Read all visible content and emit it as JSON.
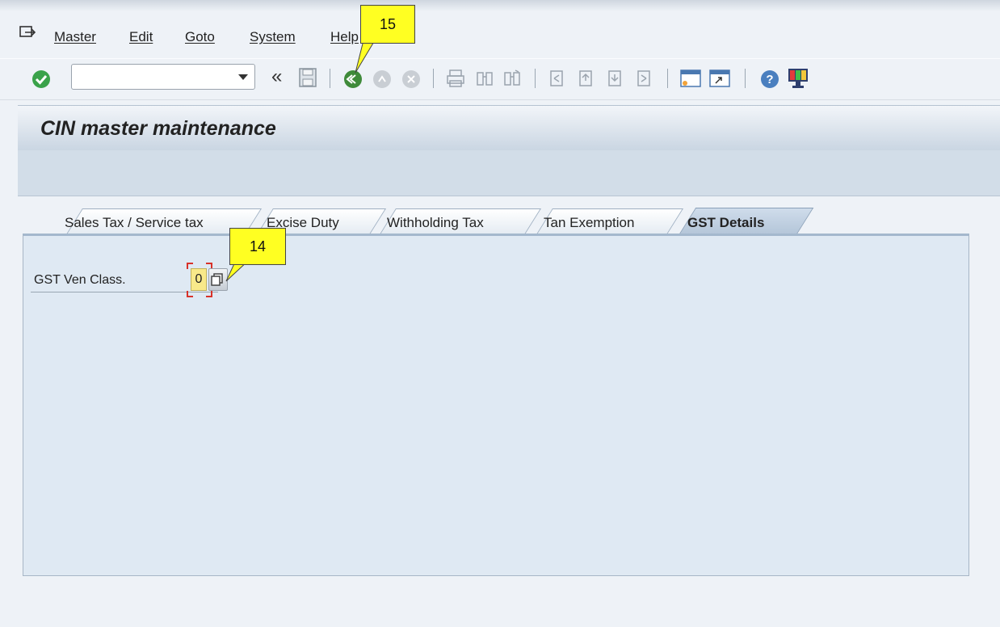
{
  "menu": {
    "items": [
      "Master",
      "Edit",
      "Goto",
      "System",
      "Help"
    ]
  },
  "toolbar": {
    "command_field_value": "",
    "icons": [
      "enter-icon",
      "back-arrows-icon",
      "save-icon",
      "back-icon",
      "exit-icon",
      "cancel-icon",
      "print-icon",
      "find-icon",
      "find-next-icon",
      "first-page-icon",
      "previous-page-icon",
      "next-page-icon",
      "last-page-icon",
      "create-session-icon",
      "shortcut-icon",
      "help-icon",
      "customize-layout-icon"
    ]
  },
  "title": {
    "text": "CIN master maintenance"
  },
  "tabs": [
    {
      "label": "Sales Tax / Service tax",
      "active": false
    },
    {
      "label": "Excise Duty",
      "active": false
    },
    {
      "label": "Withholding Tax",
      "active": false
    },
    {
      "label": "Tan Exemption",
      "active": false
    },
    {
      "label": "GST Details",
      "active": true
    }
  ],
  "form": {
    "gst_ven_class_label": "GST Ven Class.",
    "gst_ven_class_value": "0"
  },
  "callouts": {
    "step_15": "15",
    "step_14": "14"
  },
  "colors": {
    "callout_yellow": "#ffff22",
    "required_marker": "#d8322a",
    "enter_green": "#3aa24a"
  }
}
